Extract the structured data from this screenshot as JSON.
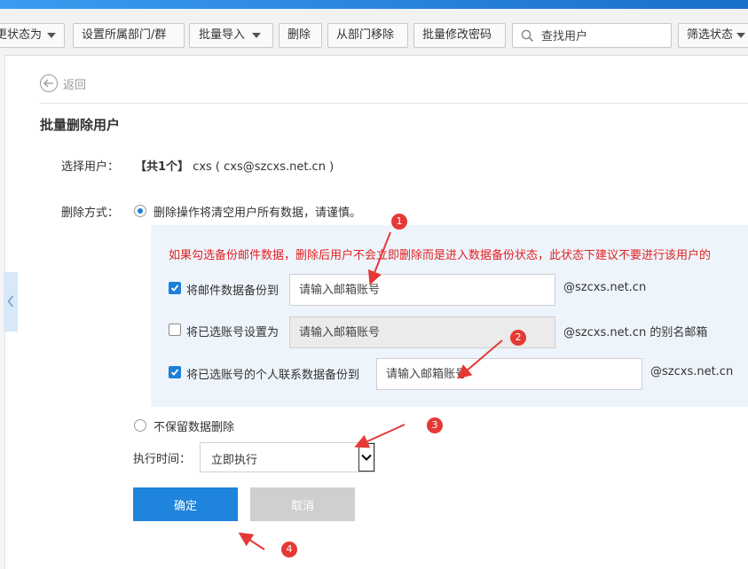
{
  "toolbar": {
    "change_status_label": "更状态为",
    "set_department_label": "设置所属部门/群",
    "batch_import_label": "批量导入",
    "delete_label": "删除",
    "remove_from_dept_label": "从部门移除",
    "batch_password_label": "批量修改密码",
    "search_placeholder": "查找用户",
    "filter_status_label": "筛选状态"
  },
  "page": {
    "back_label": "返回",
    "title": "批量删除用户"
  },
  "form": {
    "select_user_label": "选择用户：",
    "selected_count": "【共1个】",
    "selected_user": "cxs ( cxs@szcxs.net.cn )",
    "delete_method_label": "删除方式：",
    "option_clear": "删除操作将清空用户所有数据，请谨慎。",
    "warning": "如果勾选备份邮件数据，删除后用户不会立即删除而是进入数据备份状态，此状态下建议不要进行该用户的",
    "backup_mail": {
      "checked": true,
      "label": "将邮件数据备份到",
      "placeholder": "请输入邮箱账号",
      "suffix": "@szcxs.net.cn"
    },
    "set_alias": {
      "checked": false,
      "label": "将已选账号设置为",
      "placeholder": "请输入邮箱账号",
      "suffix": "@szcxs.net.cn 的别名邮箱"
    },
    "backup_contacts": {
      "checked": true,
      "label": "将已选账号的个人联系数据备份到",
      "placeholder": "请输入邮箱账号",
      "suffix": "@szcxs.net.cn"
    },
    "option_no_keep": "不保留数据删除",
    "exec_time_label": "执行时间：",
    "exec_time_value": "立即执行",
    "ok_label": "确定",
    "cancel_label": "取消"
  },
  "annotations": {
    "badge1": "1",
    "badge2": "2",
    "badge3": "3",
    "badge4": "4"
  },
  "colors": {
    "primary": "#1e84dc",
    "warning": "#e02222",
    "annotation": "#e53935",
    "panel": "#eef4fb"
  }
}
